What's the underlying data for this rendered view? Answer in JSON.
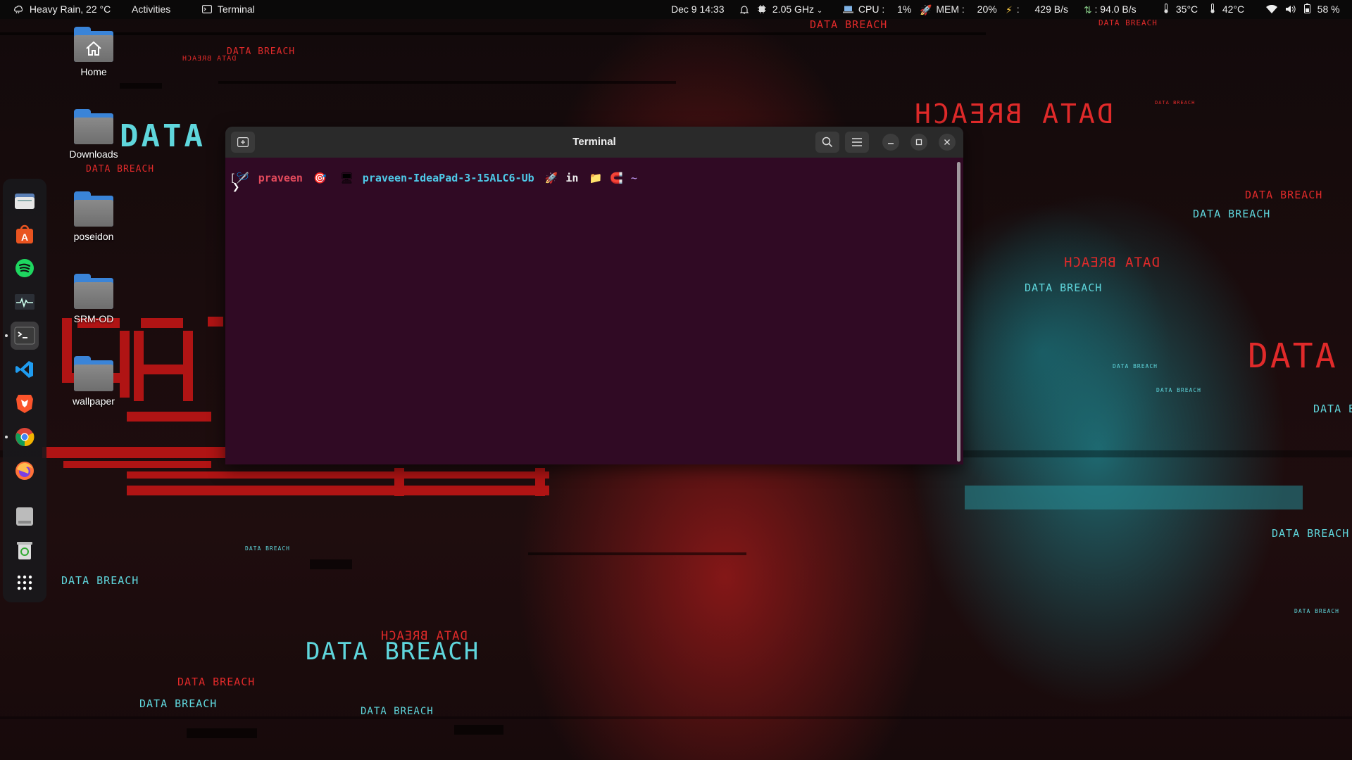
{
  "topbar": {
    "weather": "Heavy Rain, 22 °C",
    "activities": "Activities",
    "app": "Terminal",
    "datetime": "Dec 9  14:33",
    "cpu_freq": "2.05 GHz",
    "cpu_label": "CPU :",
    "cpu_value": "1%",
    "mem_label": "MEM :",
    "mem_value": "20%",
    "net_down": "429 B/s",
    "net_up": ": 94.0 B/s",
    "temp1": "35°C",
    "temp2": "42°C",
    "battery": "58 %"
  },
  "desktop": {
    "icons": [
      {
        "label": "Home",
        "icon": "home-folder-icon"
      },
      {
        "label": "Downloads",
        "icon": "folder-icon"
      },
      {
        "label": "poseidon",
        "icon": "folder-icon"
      },
      {
        "label": "SRM-OD",
        "icon": "folder-icon"
      },
      {
        "label": "wallpaper",
        "icon": "folder-icon"
      }
    ]
  },
  "dock": {
    "items": [
      {
        "name": "files",
        "icon": "files-icon"
      },
      {
        "name": "software",
        "icon": "app-center-icon"
      },
      {
        "name": "spotify",
        "icon": "spotify-icon"
      },
      {
        "name": "system-monitor",
        "icon": "system-monitor-icon"
      },
      {
        "name": "terminal",
        "icon": "terminal-icon"
      },
      {
        "name": "vscode",
        "icon": "vscode-icon"
      },
      {
        "name": "brave",
        "icon": "brave-icon"
      },
      {
        "name": "chrome",
        "icon": "chrome-icon"
      },
      {
        "name": "firefox",
        "icon": "firefox-icon"
      },
      {
        "name": "drive",
        "icon": "drive-icon"
      },
      {
        "name": "trash",
        "icon": "trash-icon"
      },
      {
        "name": "show-apps",
        "icon": "grid-icon"
      }
    ]
  },
  "terminal": {
    "title": "Terminal",
    "prompt": {
      "user": "praveen",
      "host": "praveen-IdeaPad-3-15ALC6-Ub",
      "in": "in",
      "dir": "~"
    }
  },
  "wallpaper": {
    "text": "DATA BREACH",
    "big_word": "DATA",
    "colors": {
      "red": "#e02a2a",
      "cyan": "#5fd6dc"
    }
  }
}
